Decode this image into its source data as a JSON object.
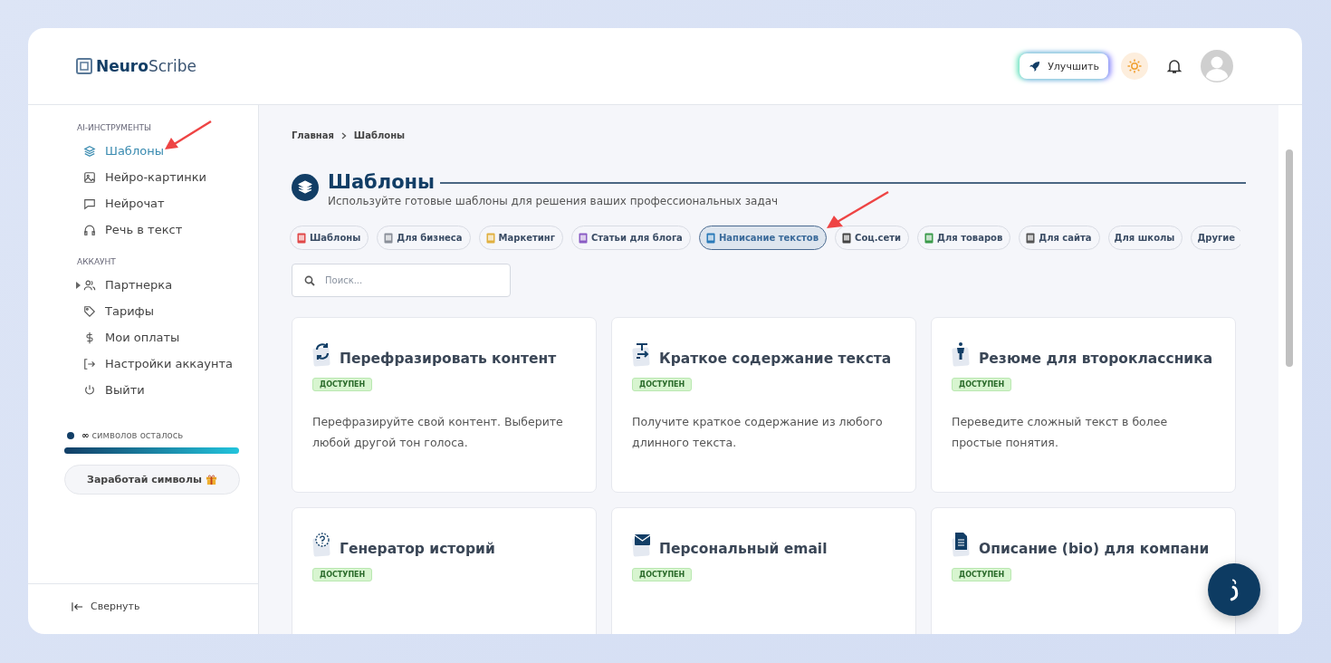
{
  "header": {
    "logo_bold": "Neuro",
    "logo_light": "Scribe",
    "upgrade_button": "Улучшить"
  },
  "sidebar": {
    "sections": [
      {
        "title": "AI-ИНСТРУМЕНТЫ",
        "items": [
          {
            "label": "Шаблоны",
            "selected": true,
            "expandable": false
          },
          {
            "label": "Нейро-картинки",
            "selected": false,
            "expandable": false
          },
          {
            "label": "Нейрочат",
            "selected": false,
            "expandable": false
          },
          {
            "label": "Речь в текст",
            "selected": false,
            "expandable": false
          }
        ]
      },
      {
        "title": "АККАУНТ",
        "items": [
          {
            "label": "Партнерка",
            "selected": false,
            "expandable": true
          },
          {
            "label": "Тарифы",
            "selected": false,
            "expandable": false
          },
          {
            "label": "Мои оплаты",
            "selected": false,
            "expandable": false
          },
          {
            "label": "Настройки аккаунта",
            "selected": false,
            "expandable": false
          },
          {
            "label": "Выйти",
            "selected": false,
            "expandable": false
          }
        ]
      }
    ],
    "symbols": {
      "count": "∞",
      "label": "символов осталось",
      "level": 1
    },
    "earn_button": "Заработай символы",
    "collapse": "Свернуть"
  },
  "breadcrumb": [
    "Главная",
    "Шаблоны"
  ],
  "page": {
    "title": "Шаблоны",
    "subtitle": "Используйте готовые шаблоны для решения ваших профессиональных задач"
  },
  "categories": [
    {
      "label": "Шаблоны",
      "selected": false
    },
    {
      "label": "Для бизнеса",
      "selected": false
    },
    {
      "label": "Маркетинг",
      "selected": false
    },
    {
      "label": "Статьи для блога",
      "selected": false
    },
    {
      "label": "Написание текстов",
      "selected": true
    },
    {
      "label": "Соц.сети",
      "selected": false
    },
    {
      "label": "Для товаров",
      "selected": false
    },
    {
      "label": "Для сайта",
      "selected": false
    },
    {
      "label": "Для школы",
      "selected": false
    },
    {
      "label": "Другие",
      "selected": false
    }
  ],
  "search": {
    "placeholder": "Поиск..."
  },
  "templates": [
    {
      "title": "Перефразировать контент",
      "badge": "ДОСТУПЕН",
      "description": "Перефразируйте свой контент. Выберите любой другой тон голоса."
    },
    {
      "title": "Краткое содержание текста",
      "badge": "ДОСТУПЕН",
      "description": "Получите краткое содержание из любого длинного текста."
    },
    {
      "title": "Резюме для второклассника",
      "badge": "ДОСТУПЕН",
      "description": "Переведите сложный текст в более простые понятия."
    },
    {
      "title": "Генератор историй",
      "badge": "ДОСТУПЕН"
    },
    {
      "title": "Персональный email",
      "badge": "ДОСТУПЕН"
    },
    {
      "title": "Описание (bio) для компани",
      "badge": "ДОСТУПЕН"
    }
  ]
}
